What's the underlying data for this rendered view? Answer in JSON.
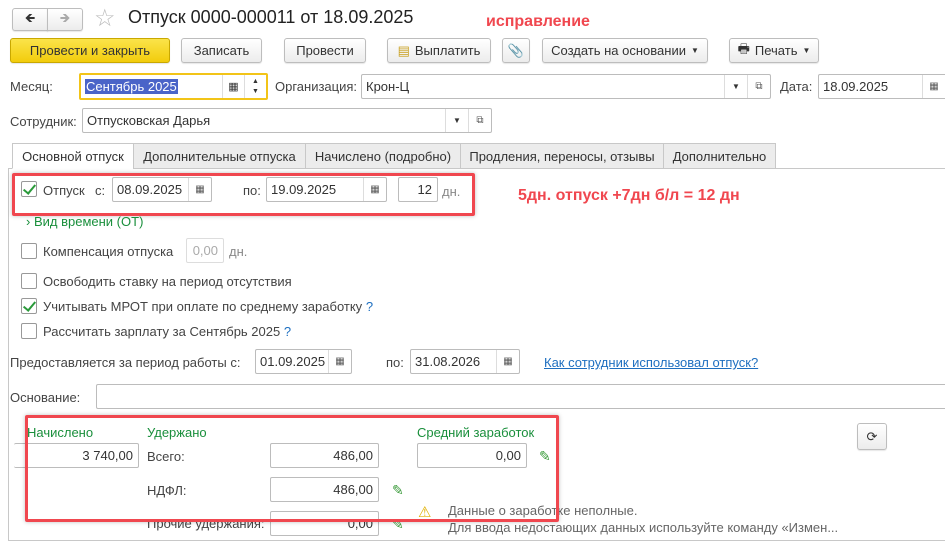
{
  "header": {
    "title": "Отпуск 0000-000011 от 18.09.2025",
    "annotation": "исправление"
  },
  "toolbar": {
    "post_close": "Провести и закрыть",
    "save": "Записать",
    "post": "Провести",
    "pay": "Выплатить",
    "create_based": "Создать на основании",
    "print": "Печать"
  },
  "fields": {
    "month_label": "Месяц:",
    "month": "Сентябрь 2025",
    "org_label": "Организация:",
    "org": "Крон-Ц",
    "date_label": "Дата:",
    "date": "18.09.2025",
    "employee_label": "Сотрудник:",
    "employee": "Отпусковская Дарья"
  },
  "tabs": [
    "Основной отпуск",
    "Дополнительные отпуска",
    "Начислено (подробно)",
    "Продления, переносы, отзывы",
    "Дополнительно"
  ],
  "vacation": {
    "label": "Отпуск",
    "from_label": "с:",
    "from": "08.09.2025",
    "to_label": "по:",
    "to": "19.09.2025",
    "days": "12",
    "days_unit": "дн.",
    "checked": true
  },
  "annotation2": "5дн. отпуск +7дн б/л = 12 дн",
  "time_type": "Вид времени (ОТ)",
  "compensation": {
    "label": "Компенсация отпуска",
    "value": "0,00",
    "unit": "дн.",
    "checked": false
  },
  "free_rate": {
    "label": "Освободить ставку на период отсутствия",
    "checked": false
  },
  "mrot": {
    "label": "Учитывать МРОТ при оплате по среднему заработку",
    "help": "?",
    "checked": true
  },
  "calc_salary": {
    "label": "Рассчитать зарплату за Сентябрь 2025",
    "help": "?",
    "checked": false
  },
  "period": {
    "label": "Предоставляется за период работы с:",
    "from": "01.09.2025",
    "to_label": "по:",
    "to": "31.08.2026",
    "link": "Как сотрудник использовал отпуск?"
  },
  "basis": {
    "label": "Основание:",
    "value": ""
  },
  "totals": {
    "accrued_label": "Начислено",
    "accrued": "3 740,00",
    "withheld_label": "Удержано",
    "total_label": "Всего:",
    "total": "486,00",
    "ndfl_label": "НДФЛ:",
    "ndfl": "486,00",
    "other_label": "Прочие удержания:",
    "other": "0,00",
    "avg_label": "Средний заработок",
    "avg": "0,00"
  },
  "warning": {
    "line1": "Данные о заработке неполные.",
    "line2": "Для ввода недостающих данных используйте команду «Измен..."
  },
  "colors": {
    "accent": "#f5d31c",
    "annotation": "#f0474f",
    "green": "#1a8f3c"
  }
}
